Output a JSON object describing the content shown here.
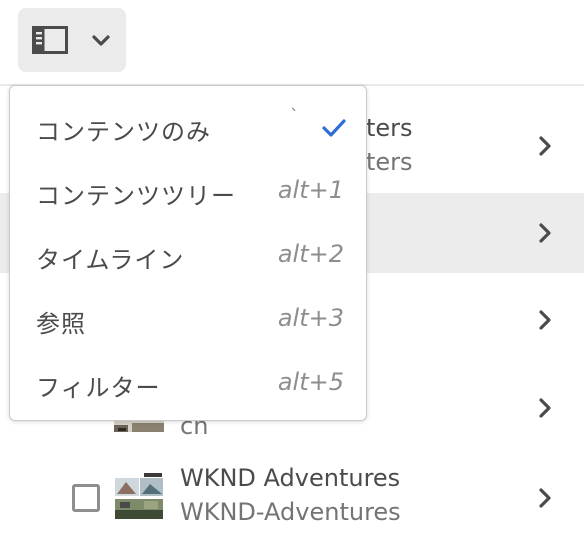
{
  "toolbar": {
    "view_switcher": {
      "icon": "rail-icon",
      "dropdown_icon": "chevron-down-icon",
      "color": "#4b4b4b"
    }
  },
  "list": {
    "rows": [
      {
        "title": "ters",
        "subtitle": "ters",
        "selected": false
      },
      {
        "title": "",
        "subtitle": "",
        "selected": true
      },
      {
        "title": "",
        "subtitle": "",
        "selected": false
      },
      {
        "title": "",
        "subtitle": "cn",
        "selected": false
      },
      {
        "title": "WKND Adventures",
        "subtitle": "WKND-Adventures",
        "selected": false
      }
    ],
    "selected_row_color": "#ececec"
  },
  "menu": {
    "items": [
      {
        "label": "コンテンツのみ",
        "shortcut_tick": "`",
        "checked": true
      },
      {
        "label": "コンテンツツリー",
        "shortcut": "alt+1"
      },
      {
        "label": "タイムライン",
        "shortcut": "alt+2"
      },
      {
        "label": "参照",
        "shortcut": "alt+3"
      },
      {
        "label": "フィルター",
        "shortcut": "alt+5"
      }
    ],
    "check_color": "#2d6fd6"
  }
}
